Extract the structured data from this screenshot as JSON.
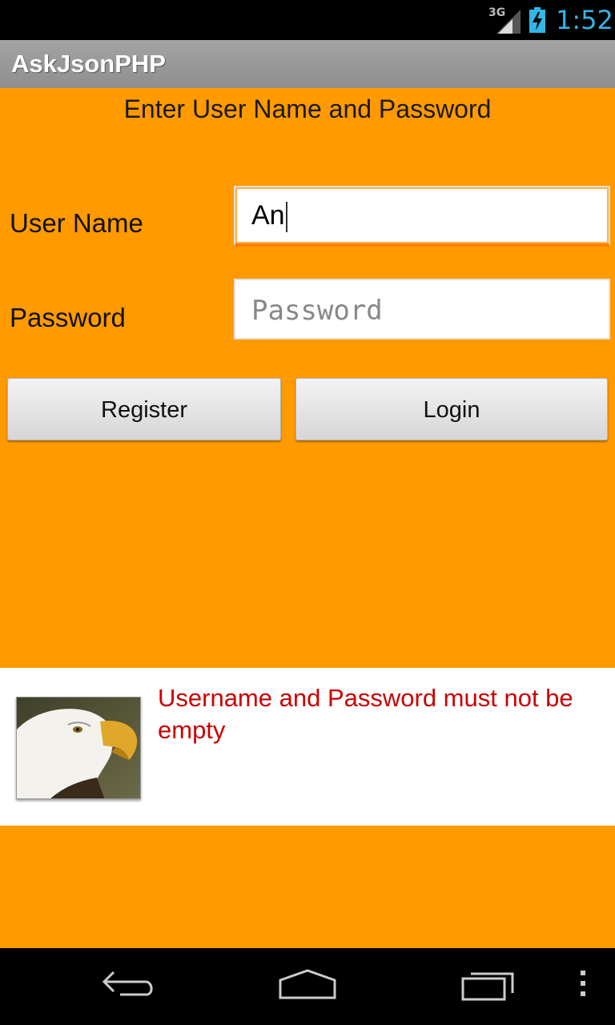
{
  "status_bar": {
    "network": "3G",
    "time": "1:52",
    "accent_color": "#33b5e5"
  },
  "app": {
    "title": "AskJsonPHP"
  },
  "form": {
    "heading": "Enter User Name and Password",
    "username_label": "User Name",
    "username_value": "An",
    "password_label": "Password",
    "password_placeholder": "Password",
    "register_label": "Register",
    "login_label": "Login",
    "background_color": "#ff9a00"
  },
  "toast": {
    "message": "Username and Password must not be empty",
    "message_color": "#cc0000",
    "image": "eagle-image"
  },
  "nav_bar": {
    "icons": [
      "back-icon",
      "home-icon",
      "recents-icon",
      "overflow-menu-icon"
    ]
  }
}
